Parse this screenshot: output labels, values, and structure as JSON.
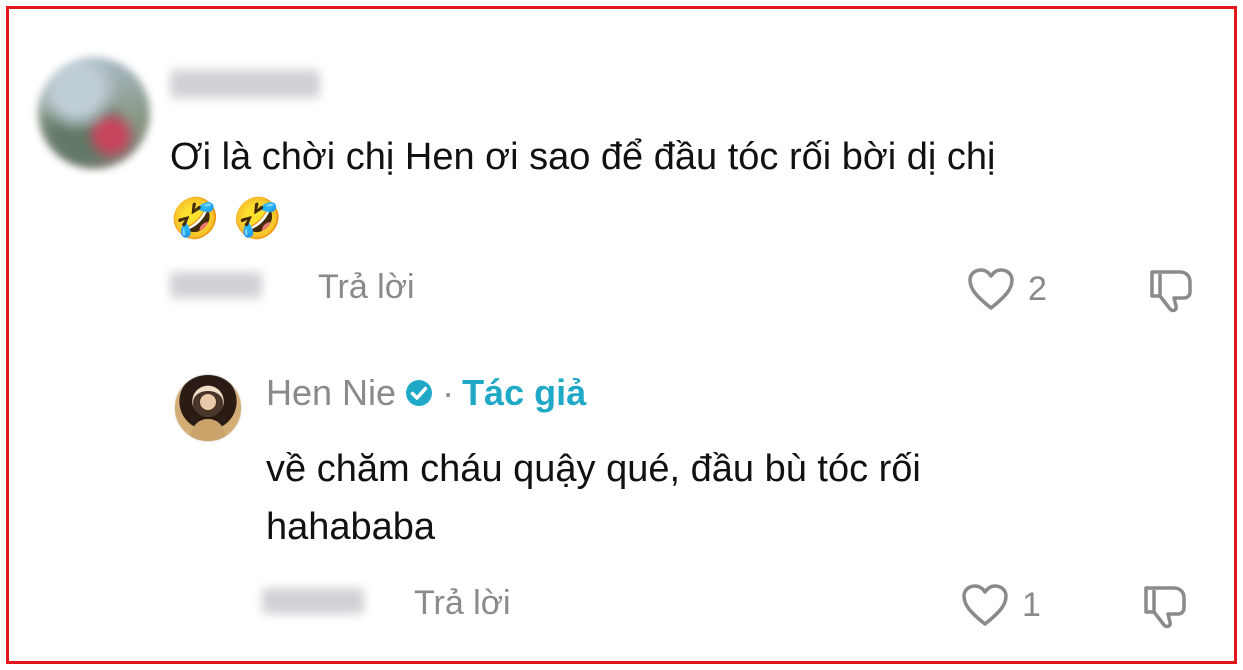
{
  "comment": {
    "text": "Ơi là chời chị Hen ơi sao để đầu tóc rối bời dị chị",
    "emoji": "🤣 🤣",
    "reply_label": "Trả lời",
    "like_count": "2"
  },
  "reply": {
    "author": "Hen Nie",
    "separator": "·",
    "author_tag": "Tác giả",
    "text_line1": "về chăm cháu quậy qué, đầu bù tóc rối",
    "text_line2": "hahababa",
    "reply_label": "Trả lời",
    "like_count": "1"
  },
  "colors": {
    "frame": "#e3161b",
    "muted": "#8a8a8a",
    "author_tag": "#20a9c7",
    "verified": "#20a9c7"
  }
}
